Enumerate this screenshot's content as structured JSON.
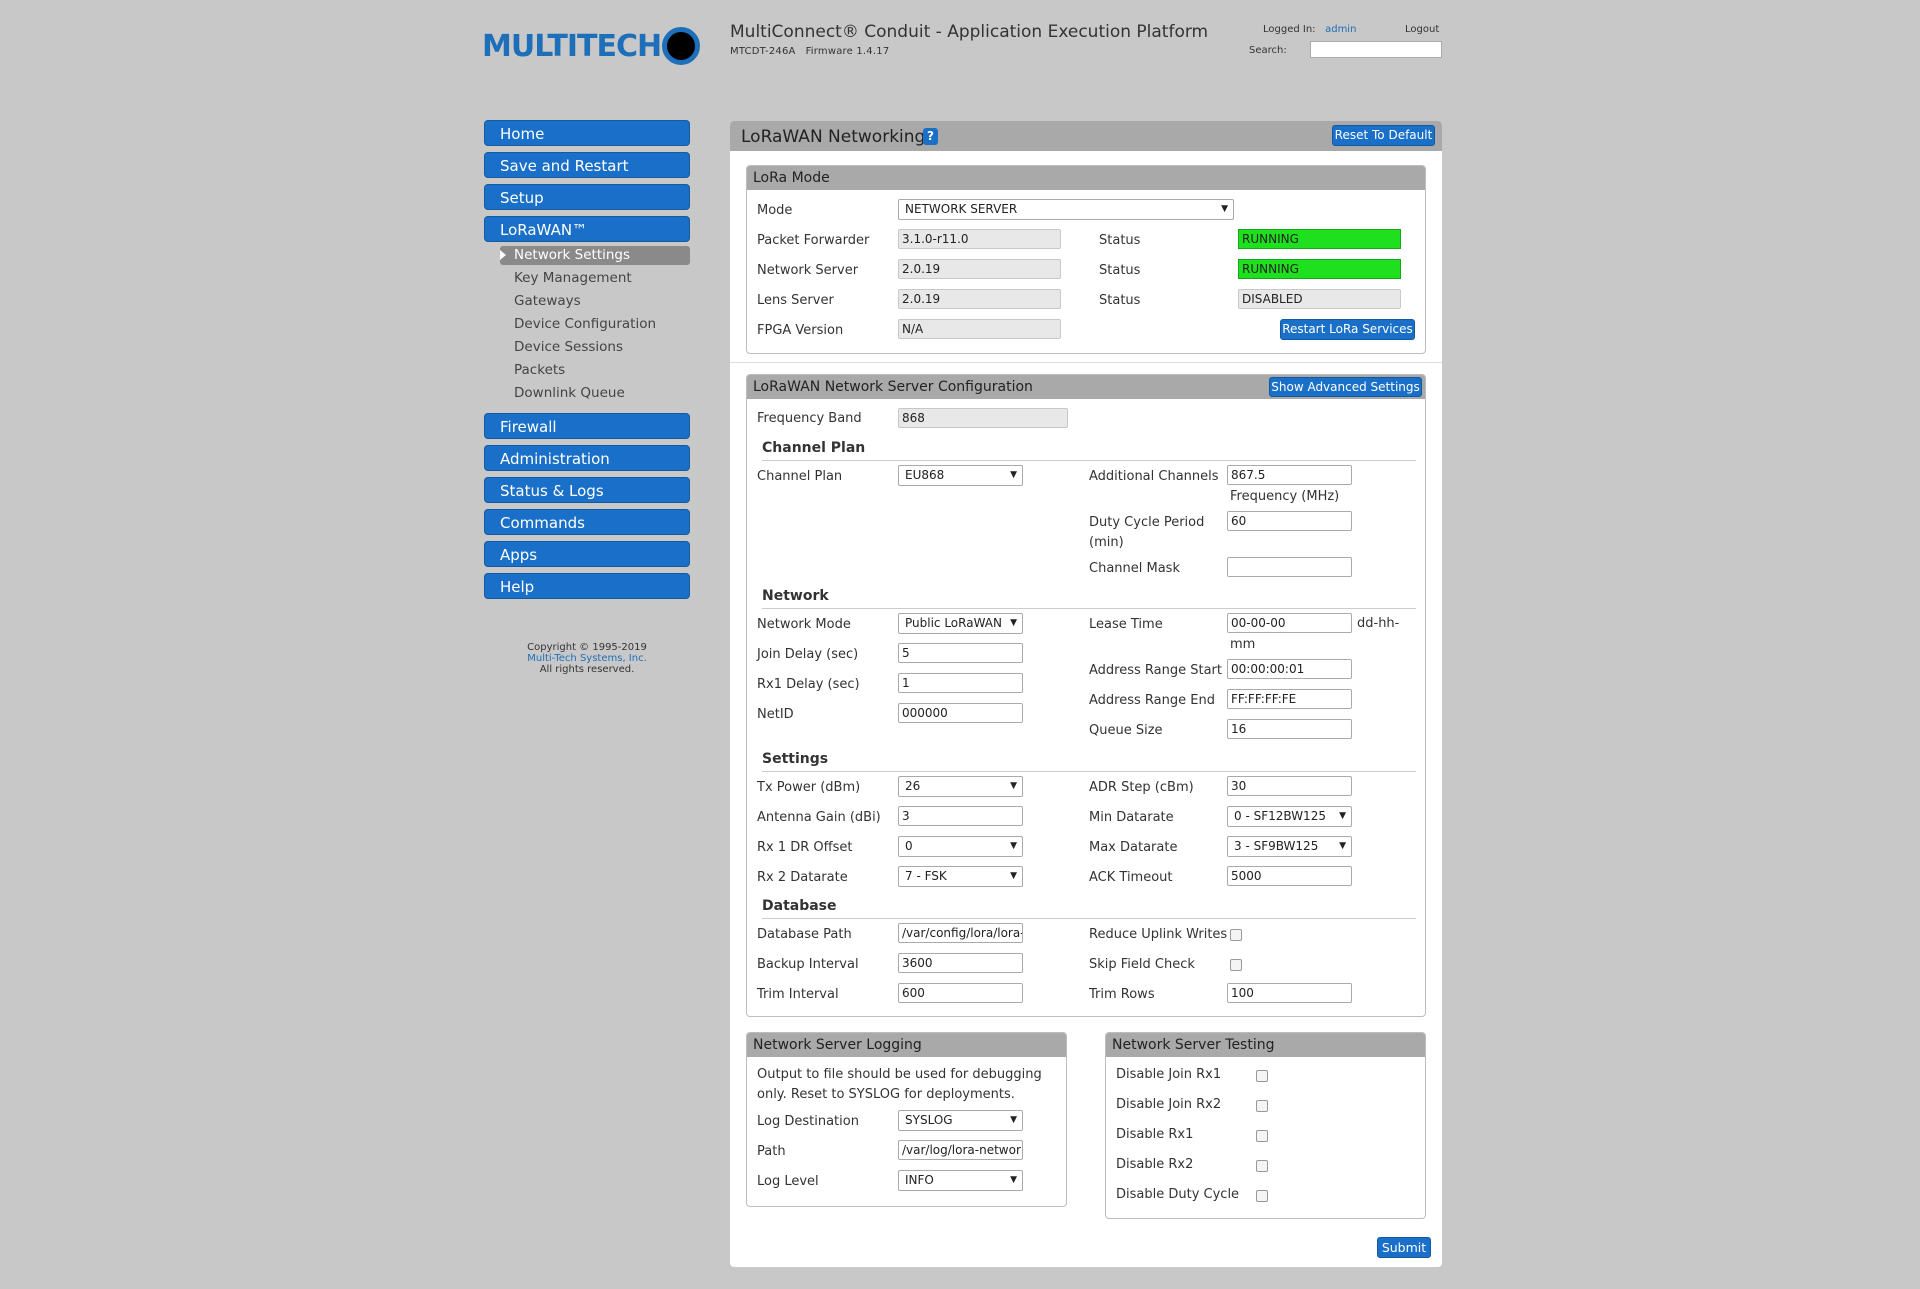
{
  "header": {
    "logo_text_a": "MULTI",
    "logo_text_b": "TECH",
    "title": "MultiConnect® Conduit - Application Execution Platform",
    "model": "MTCDT-246A",
    "firmware": "Firmware 1.4.17",
    "logged_in_label": "Logged In:",
    "user": "admin",
    "logout": "Logout",
    "search_label": "Search:",
    "search_value": ""
  },
  "nav": {
    "home": "Home",
    "save_restart": "Save and Restart",
    "setup": "Setup",
    "lorawan": "LoRaWAN™",
    "sub": [
      "Network Settings",
      "Key Management",
      "Gateways",
      "Device Configuration",
      "Device Sessions",
      "Packets",
      "Downlink Queue"
    ],
    "firewall": "Firewall",
    "administration": "Administration",
    "status_logs": "Status & Logs",
    "commands": "Commands",
    "apps": "Apps",
    "help": "Help"
  },
  "copyright": {
    "line1": "Copyright © 1995-2019",
    "line2": "Multi-Tech Systems, Inc.",
    "line3": "All rights reserved."
  },
  "page": {
    "title": "LoRaWAN Networking",
    "help_icon": "?",
    "reset_button": "Reset To Default",
    "submit_button": "Submit"
  },
  "lora_mode": {
    "title": "LoRa Mode",
    "mode_label": "Mode",
    "mode_value": "NETWORK SERVER",
    "packet_forwarder_label": "Packet Forwarder",
    "packet_forwarder_value": "3.1.0-r11.0",
    "network_server_label": "Network Server",
    "network_server_value": "2.0.19",
    "lens_server_label": "Lens Server",
    "lens_server_value": "2.0.19",
    "fpga_label": "FPGA Version",
    "fpga_value": "N/A",
    "status_label": "Status",
    "pf_status": "RUNNING",
    "ns_status": "RUNNING",
    "lens_status": "DISABLED",
    "restart_button": "Restart LoRa Services",
    "status_colors": {
      "running": "#1fe01f",
      "disabled": "#e8e8e8"
    }
  },
  "ns_config": {
    "title": "LoRaWAN Network Server Configuration",
    "advanced_button": "Show Advanced Settings",
    "frequency_band_label": "Frequency Band",
    "frequency_band_value": "868",
    "channel_plan_section": "Channel Plan",
    "channel_plan_label": "Channel Plan",
    "channel_plan_value": "EU868",
    "additional_channels_label": "Additional Channels",
    "additional_channels_value": "867.5",
    "frequency_unit": "Frequency (MHz)",
    "duty_cycle_label_a": "Duty Cycle Period",
    "duty_cycle_label_b": "(min)",
    "duty_cycle_value": "60",
    "channel_mask_label": "Channel Mask",
    "channel_mask_value": "",
    "network_section": "Network",
    "network_mode_label": "Network Mode",
    "network_mode_value": "Public LoRaWAN",
    "join_delay_label": "Join Delay (sec)",
    "join_delay_value": "5",
    "rx1_delay_label": "Rx1 Delay (sec)",
    "rx1_delay_value": "1",
    "netid_label": "NetID",
    "netid_value": "000000",
    "lease_time_label": "Lease Time",
    "lease_time_value": "00-00-00",
    "lease_unit_a": "dd-hh-",
    "lease_unit_b": "mm",
    "addr_start_label": "Address Range Start",
    "addr_start_value": "00:00:00:01",
    "addr_end_label": "Address Range End",
    "addr_end_value": "FF:FF:FF:FE",
    "queue_size_label": "Queue Size",
    "queue_size_value": "16",
    "settings_section": "Settings",
    "tx_power_label": "Tx Power (dBm)",
    "tx_power_value": "26",
    "antenna_gain_label": "Antenna Gain (dBi)",
    "antenna_gain_value": "3",
    "rx1_dr_offset_label": "Rx 1 DR Offset",
    "rx1_dr_offset_value": "0",
    "rx2_datarate_label": "Rx 2 Datarate",
    "rx2_datarate_value": "7 - FSK",
    "adr_step_label": "ADR Step (cBm)",
    "adr_step_value": "30",
    "min_dr_label": "Min Datarate",
    "min_dr_value": "0 - SF12BW125",
    "max_dr_label": "Max Datarate",
    "max_dr_value": "3 - SF9BW125",
    "ack_timeout_label": "ACK Timeout",
    "ack_timeout_value": "5000",
    "database_section": "Database",
    "db_path_label": "Database Path",
    "db_path_value": "/var/config/lora/lora-ne",
    "backup_interval_label": "Backup Interval",
    "backup_interval_value": "3600",
    "trim_interval_label": "Trim Interval",
    "trim_interval_value": "600",
    "reduce_uplink_label": "Reduce Uplink Writes",
    "skip_field_label": "Skip Field Check",
    "trim_rows_label": "Trim Rows",
    "trim_rows_value": "100"
  },
  "logging": {
    "title": "Network Server Logging",
    "note_a": "Output to file should be used for debugging",
    "note_b": "only. Reset to SYSLOG for deployments.",
    "dest_label": "Log Destination",
    "dest_value": "SYSLOG",
    "path_label": "Path",
    "path_value": "/var/log/lora-network-s",
    "level_label": "Log Level",
    "level_value": "INFO"
  },
  "testing": {
    "title": "Network Server Testing",
    "items": [
      "Disable Join Rx1",
      "Disable Join Rx2",
      "Disable Rx1",
      "Disable Rx2",
      "Disable Duty Cycle"
    ]
  }
}
